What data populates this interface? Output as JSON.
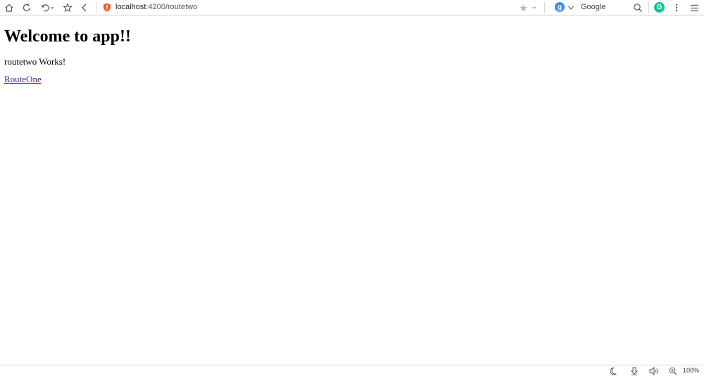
{
  "toolbar": {
    "url_host": "localhost",
    "url_rest": ":4200/routetwo",
    "search_engine_letter": "g",
    "search_label": "Google",
    "grammarly_letter": "G",
    "icons": [
      "home-icon",
      "refresh-icon",
      "undo-icon",
      "star-outline-icon",
      "back-icon",
      "shield-icon",
      "bookmark-star-icon",
      "dropdown-icon",
      "search-icon",
      "menu-dots-icon",
      "hamburger-menu-icon"
    ]
  },
  "page": {
    "heading": "Welcome to app!!",
    "message": "routetwo Works!",
    "link_label": "RouteOne"
  },
  "statusbar": {
    "icons": [
      "night-mode-icon",
      "download-icon",
      "speaker-icon",
      "zoom-icon"
    ],
    "zoom_level": "100%"
  },
  "colors": {
    "link_visited": "#551a8b",
    "shield": "#e8622c",
    "search_engine": "#3b8ef0",
    "grammarly": "#15c39a"
  }
}
